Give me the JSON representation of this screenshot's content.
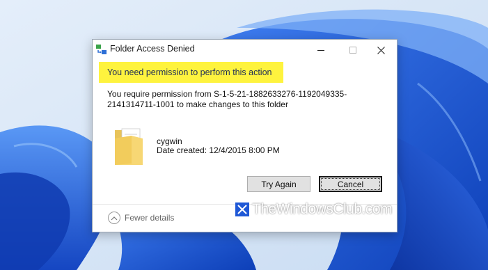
{
  "dialog": {
    "title": "Folder Access Denied",
    "headline": "You need permission to perform this action",
    "message": "You require permission from S-1-5-21-1882633276-1192049335-2141314711-1001 to make changes to this folder",
    "folder": {
      "name": "cygwin",
      "date_created": "Date created: 12/4/2015 8:00 PM",
      "icon": "folder-icon"
    },
    "buttons": {
      "try_again": "Try Again",
      "cancel": "Cancel"
    },
    "footer": {
      "details_toggle": "Fewer details"
    }
  },
  "watermark": {
    "text": "TheWindowsClub.com"
  },
  "colors": {
    "headline_highlight": "#fef33e",
    "headline_text": "#1f2d57",
    "wallpaper_blue": "#1f58d6"
  }
}
